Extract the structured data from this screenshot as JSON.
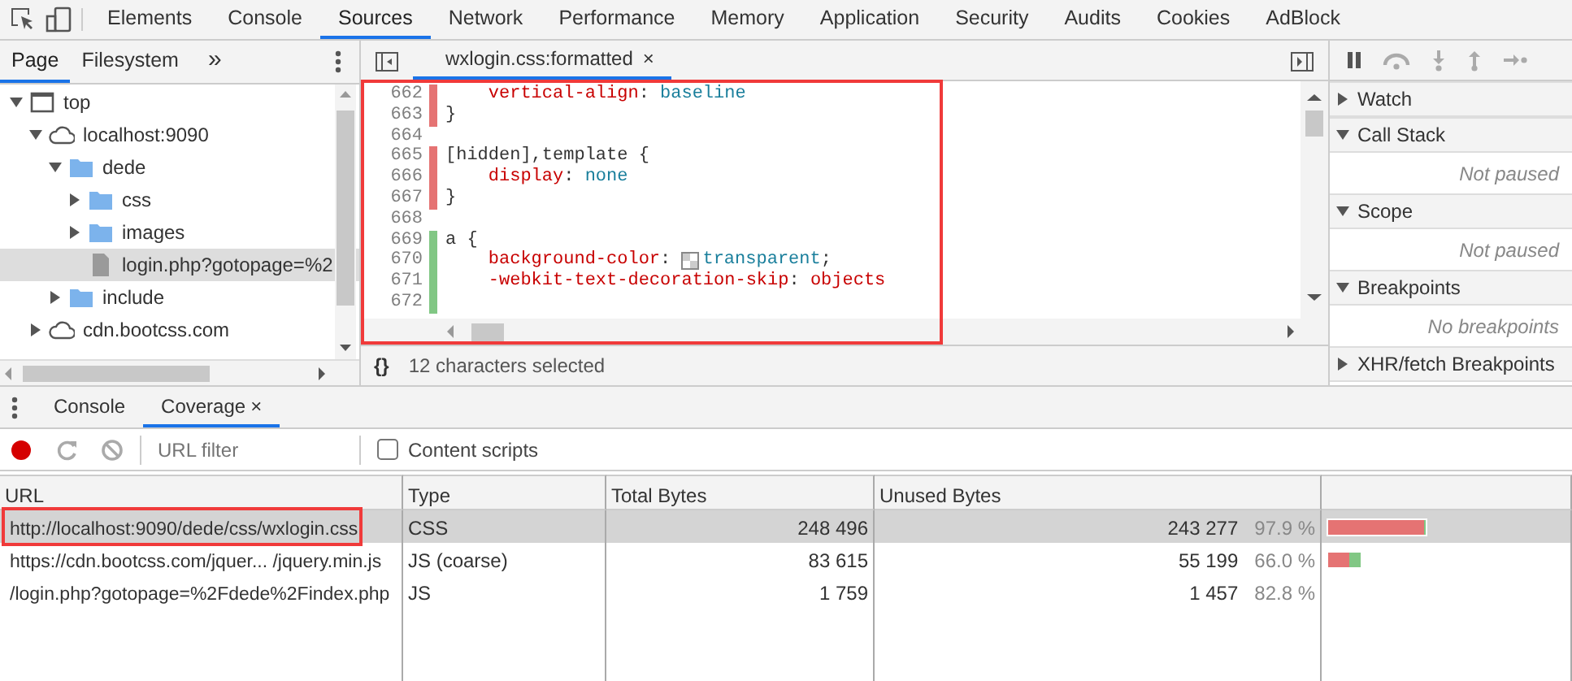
{
  "main_tabs": [
    {
      "label": "Elements",
      "selected": false
    },
    {
      "label": "Console",
      "selected": false
    },
    {
      "label": "Sources",
      "selected": true
    },
    {
      "label": "Network",
      "selected": false
    },
    {
      "label": "Performance",
      "selected": false
    },
    {
      "label": "Memory",
      "selected": false
    },
    {
      "label": "Application",
      "selected": false
    },
    {
      "label": "Security",
      "selected": false
    },
    {
      "label": "Audits",
      "selected": false
    },
    {
      "label": "Cookies",
      "selected": false
    },
    {
      "label": "AdBlock",
      "selected": false
    }
  ],
  "navigator": {
    "tabs": [
      {
        "label": "Page",
        "selected": true
      },
      {
        "label": "Filesystem",
        "selected": false
      }
    ],
    "more": "»",
    "tree": [
      {
        "label": "top",
        "kind": "frame",
        "expanded": true,
        "selected": false,
        "children": [
          {
            "label": "localhost:9090",
            "kind": "domain",
            "expanded": true,
            "selected": false,
            "children": [
              {
                "label": "dede",
                "kind": "folder",
                "expanded": true,
                "selected": false,
                "children": [
                  {
                    "label": "css",
                    "kind": "folder",
                    "expanded": false,
                    "selected": false
                  },
                  {
                    "label": "images",
                    "kind": "folder",
                    "expanded": false,
                    "selected": false
                  },
                  {
                    "label": "login.php?gotopage=%2",
                    "kind": "file",
                    "selected": true
                  }
                ]
              },
              {
                "label": "include",
                "kind": "folder",
                "expanded": false,
                "selected": false
              }
            ]
          },
          {
            "label": "cdn.bootcss.com",
            "kind": "domain",
            "expanded": false,
            "selected": false
          }
        ]
      }
    ]
  },
  "editor": {
    "tab": {
      "title": "wxlogin.css:formatted",
      "close": "×"
    },
    "highlighted": true,
    "lines": [
      {
        "number": "662",
        "color": "#e57373",
        "indented": true,
        "tokens": [
          {
            "kind": "property",
            "text": "vertical-align"
          },
          {
            "kind": "text",
            "text": ": "
          },
          {
            "kind": "value",
            "text": "baseline"
          }
        ]
      },
      {
        "number": "663",
        "color": "#e57373",
        "indented": false,
        "tokens": [
          {
            "kind": "text",
            "text": "}"
          }
        ]
      },
      {
        "number": "664"
      },
      {
        "number": "665",
        "color": "#e57373",
        "indented": false,
        "tokens": [
          {
            "kind": "text",
            "text": "[hidden],template {"
          }
        ]
      },
      {
        "number": "666",
        "color": "#e57373",
        "indented": true,
        "tokens": [
          {
            "kind": "property",
            "text": "display"
          },
          {
            "kind": "text",
            "text": ": "
          },
          {
            "kind": "value",
            "text": "none"
          }
        ]
      },
      {
        "number": "667",
        "color": "#e57373",
        "indented": false,
        "tokens": [
          {
            "kind": "text",
            "text": "}"
          }
        ]
      },
      {
        "number": "668"
      },
      {
        "number": "669",
        "color": "#81c784",
        "indented": false,
        "tokens": [
          {
            "kind": "text",
            "text": "a {"
          }
        ]
      },
      {
        "number": "670",
        "color": "#81c784",
        "indented": true,
        "tokens": [
          {
            "kind": "property",
            "text": "background-color"
          },
          {
            "kind": "text",
            "text": ": "
          },
          {
            "kind": "swatch"
          },
          {
            "kind": "value",
            "text": "transparent"
          },
          {
            "kind": "text",
            "text": ";"
          }
        ]
      },
      {
        "number": "671",
        "color": "#81c784",
        "indented": true,
        "tokens": [
          {
            "kind": "property",
            "text": "-webkit-text-decoration-skip"
          },
          {
            "kind": "text",
            "text": ": "
          },
          {
            "kind": "property",
            "text": "objects"
          }
        ]
      },
      {
        "number": "672",
        "color": "#81c784"
      }
    ],
    "format_button": "{}",
    "status": "12 characters selected"
  },
  "debugger": {
    "sections": [
      {
        "title": "Watch",
        "expanded": false
      },
      {
        "title": "Call Stack",
        "expanded": true,
        "message": "Not paused"
      },
      {
        "title": "Scope",
        "expanded": true,
        "message": "Not paused"
      },
      {
        "title": "Breakpoints",
        "expanded": true,
        "message": "No breakpoints"
      },
      {
        "title": "XHR/fetch Breakpoints",
        "expanded": false
      }
    ]
  },
  "drawer": {
    "tabs": [
      {
        "label": "Console",
        "selected": false
      },
      {
        "label": "Coverage",
        "selected": true,
        "close": "×"
      }
    ],
    "recording": true,
    "filter": {
      "placeholder": "URL filter"
    },
    "content_scripts": {
      "label": "Content scripts",
      "checked": false
    },
    "table": {
      "columns": [
        "URL",
        "Type",
        "Total Bytes",
        "Unused Bytes"
      ],
      "rows": [
        {
          "url": "http://localhost:9090/dede/css/wxlogin.css",
          "type": "CSS",
          "total": "248 496",
          "unused": "243 277",
          "percent": "97.9 %",
          "level": 0.979,
          "selected": true,
          "highlighted": true
        },
        {
          "url": "https://cdn.bootcss.com/jquer... /jquery.min.js",
          "type": "JS (coarse)",
          "total": "83 615",
          "unused": "55 199",
          "percent": "66.0 %",
          "level": 0.66,
          "selected": false,
          "highlighted": false
        },
        {
          "url": "/login.php?gotopage=%2Fdede%2Findex.php",
          "type": "JS",
          "total": "1 759",
          "unused": "1 457",
          "percent": "82.8 %",
          "selected": false,
          "highlighted": false
        }
      ]
    }
  }
}
